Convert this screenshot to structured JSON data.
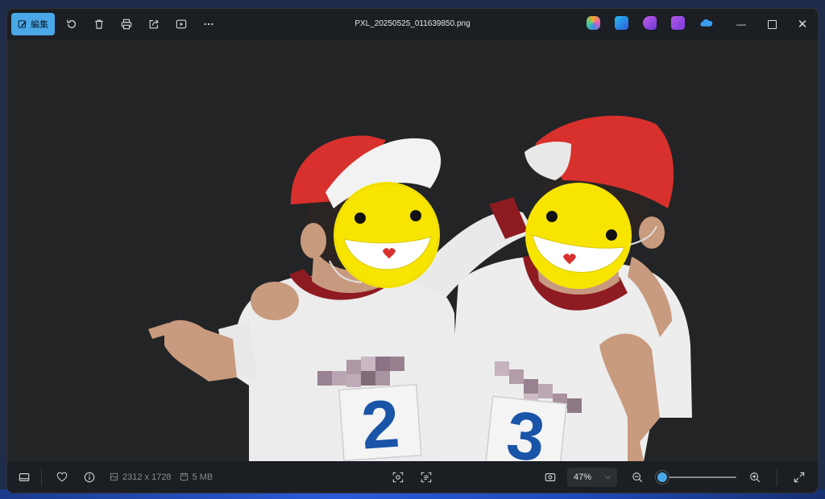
{
  "window": {
    "title": "PXL_20250525_011639850.png"
  },
  "toolbar": {
    "edit_label": "編集",
    "icons": [
      "edit-icon",
      "rotate-icon",
      "delete-icon",
      "print-icon",
      "share-icon",
      "slideshow-icon",
      "more-icon"
    ]
  },
  "app_icons": [
    {
      "name": "copilot-icon",
      "color": "#e07ac8"
    },
    {
      "name": "designer-icon",
      "color": "#3a8ee6"
    },
    {
      "name": "clipchamp-icon",
      "color": "#b466e8"
    },
    {
      "name": "video-editor-icon",
      "color": "#9a4fe0"
    },
    {
      "name": "onedrive-icon",
      "color": "#3a9ef0"
    }
  ],
  "status": {
    "dimensions": "2312 x 1728",
    "file_size": "5 MB",
    "zoom_label": "47%",
    "zoom_fraction": 0.08
  },
  "photo": {
    "jersey_left_number": "2",
    "jersey_right_number": "3"
  },
  "colors": {
    "accent": "#4aa8e8",
    "background": "#222426"
  }
}
